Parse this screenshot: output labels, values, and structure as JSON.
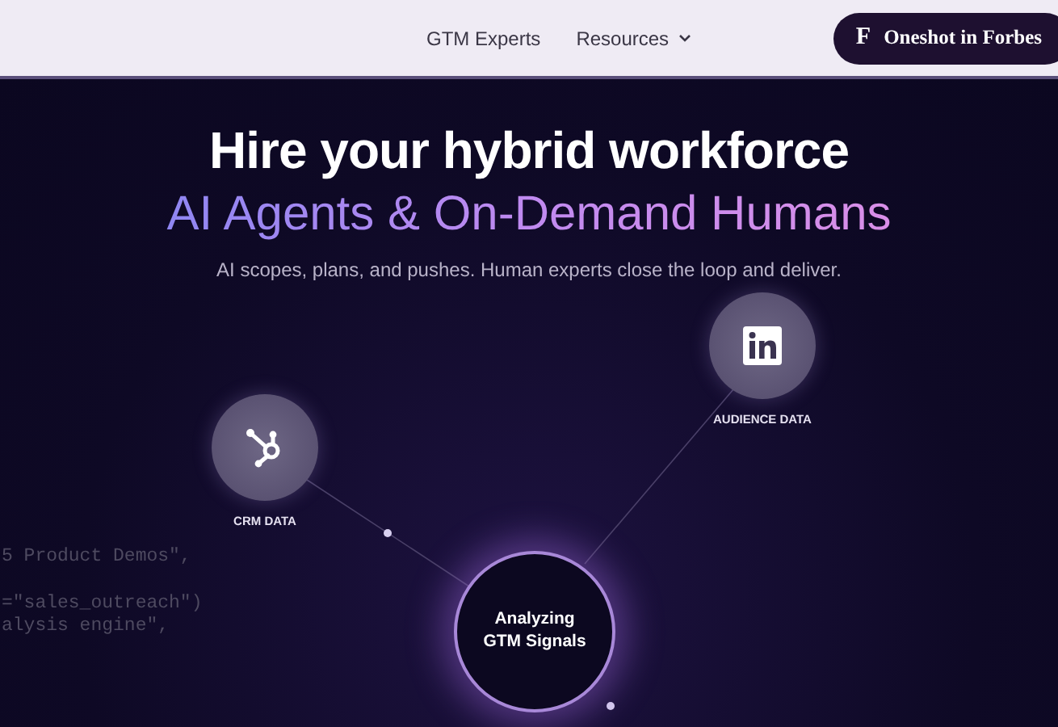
{
  "nav": {
    "links": [
      {
        "label": "GTM Experts",
        "has_caret": false
      },
      {
        "label": "Resources",
        "has_caret": true
      }
    ],
    "cta": {
      "label": "Oneshot in Forbes",
      "mark": "F"
    }
  },
  "hero": {
    "title": "Hire your hybrid workforce",
    "highlight": "AI Agents & On-Demand Humans",
    "subtitle": "AI scopes, plans, and pushes. Human experts close the loop and deliver."
  },
  "diagram": {
    "sources": [
      {
        "kind": "hubspot",
        "label": "CRM DATA"
      },
      {
        "kind": "linkedin",
        "label": "AUDIENCE DATA"
      }
    ],
    "center": {
      "lines": [
        "Analyzing",
        "GTM Signals"
      ]
    },
    "code_lines": [
      "5 Product Demos\",",
      "=\"sales_outreach\")",
      "alysis engine\","
    ]
  }
}
